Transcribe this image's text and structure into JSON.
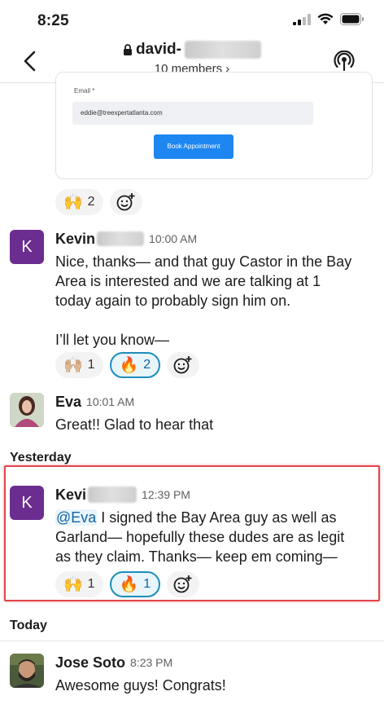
{
  "status_bar": {
    "time": "8:25"
  },
  "header": {
    "channel_prefix": "david-",
    "members_label": "10 members ›"
  },
  "booking_card": {
    "email_label": "Email *",
    "email_value": "eddie@treexpertatlanta.com",
    "button_label": "Book Appointment",
    "reactions": [
      {
        "emoji": "🙌",
        "count": "2"
      }
    ]
  },
  "messages": [
    {
      "avatar_letter": "K",
      "name": "Kevin",
      "time": "10:00 AM",
      "lines": [
        "Nice, thanks— and that guy Castor in the Bay",
        "Area is interested and we are talking at 1",
        "today again to probably sign him on."
      ],
      "line2": "I’ll let you know—",
      "reactions": [
        {
          "emoji": "🙌🏼",
          "count": "1"
        },
        {
          "emoji": "🔥",
          "count": "2"
        }
      ]
    },
    {
      "name": "Eva",
      "time": "10:01 AM",
      "text": "Great!! Glad to hear that"
    },
    {
      "avatar_letter": "K",
      "name": "Kevi",
      "time": "12:39 PM",
      "mention": "@Eva",
      "lines": [
        " I signed the Bay Area guy as well as",
        "Garland— hopefully these dudes are as legit",
        "as they claim. Thanks— keep em coming—"
      ],
      "reactions": [
        {
          "emoji": "🙌",
          "count": "1"
        },
        {
          "emoji": "🔥",
          "count": "1"
        }
      ]
    },
    {
      "name": "Jose Soto",
      "time": "8:23 PM",
      "text": "Awesome guys! Congrats!"
    }
  ],
  "day_headers": {
    "yesterday": "Yesterday",
    "today": "Today"
  },
  "colors": {
    "accent_purple": "#6b2d8f",
    "link_blue": "#1264a3",
    "highlight_red": "#e0474c",
    "button_blue": "#1e86f0"
  }
}
